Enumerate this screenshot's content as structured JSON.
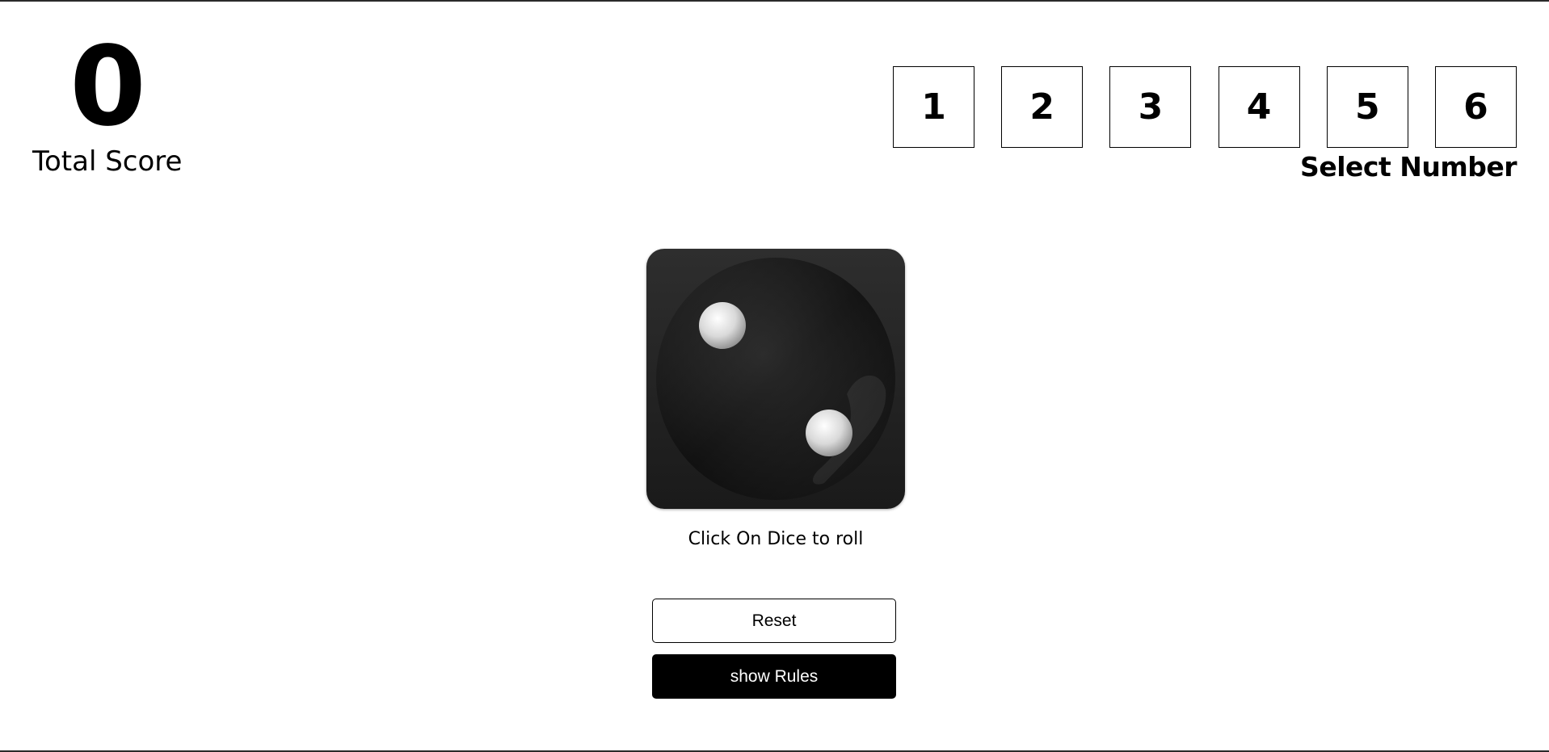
{
  "score": {
    "value": "0",
    "label": "Total Score"
  },
  "selector": {
    "numbers": [
      "1",
      "2",
      "3",
      "4",
      "5",
      "6"
    ],
    "label": "Select Number"
  },
  "dice": {
    "face_value": 2,
    "icon": "dice-two-icon",
    "hint": "Click On Dice to roll"
  },
  "buttons": {
    "reset_label": "Reset",
    "rules_label": "show Rules"
  },
  "colors": {
    "primary": "#000000",
    "background": "#ffffff",
    "dice_body": "#1f1f1f"
  }
}
